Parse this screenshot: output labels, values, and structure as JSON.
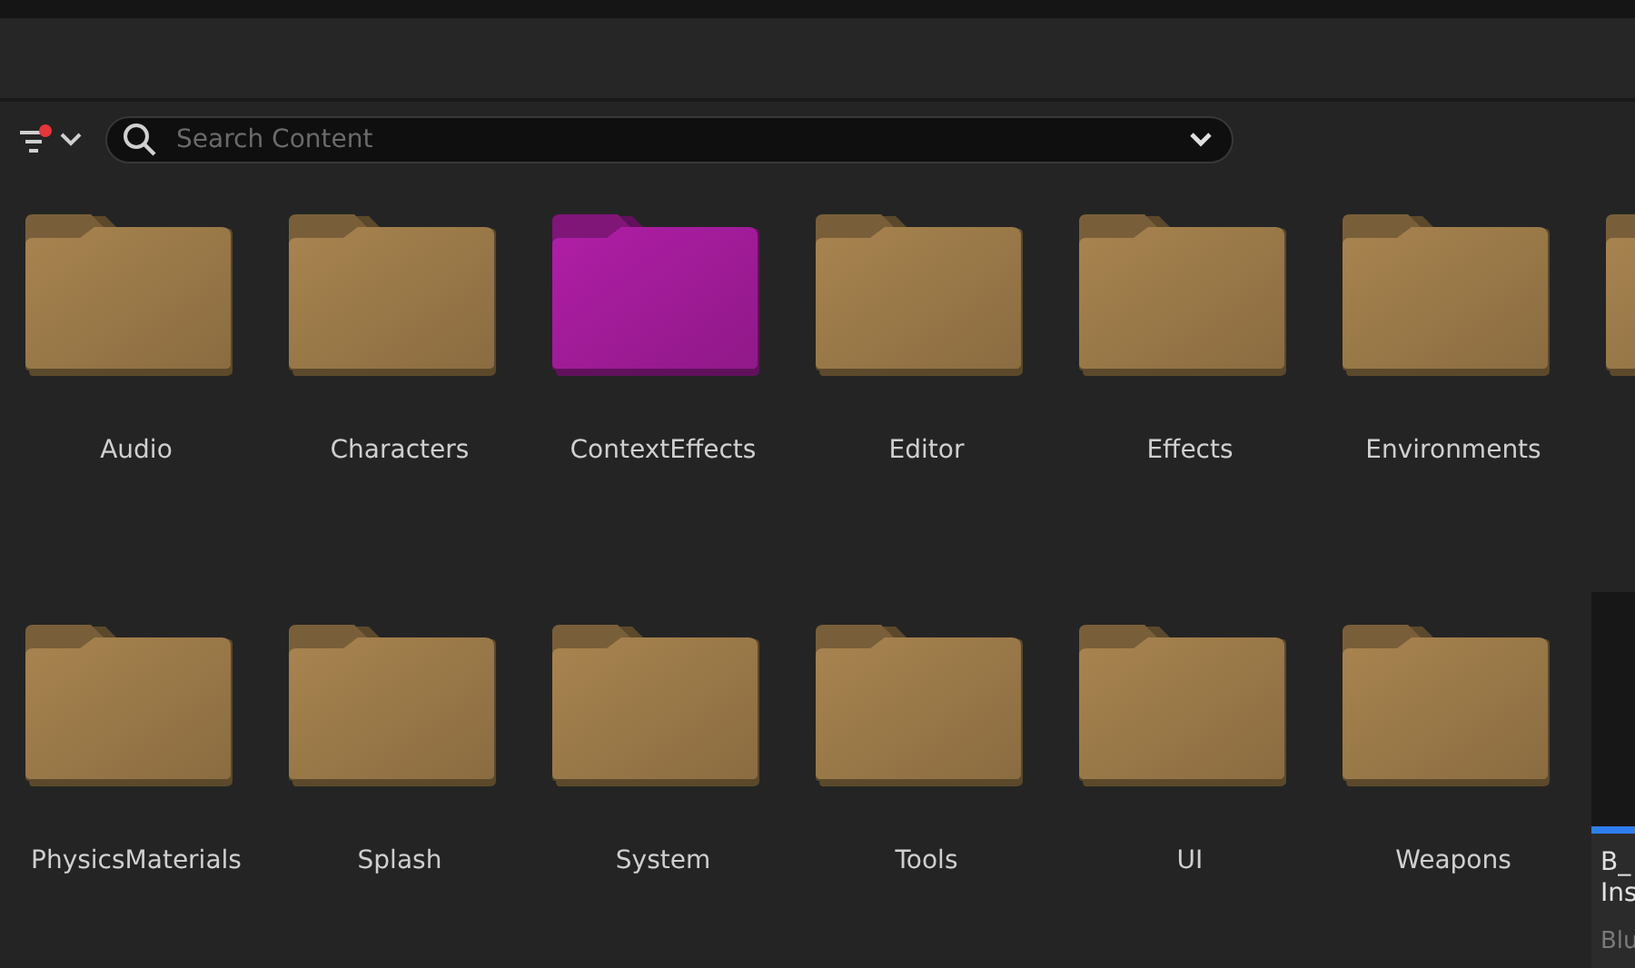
{
  "toolbar": {
    "filter_active": true,
    "search": {
      "placeholder": "Search Content"
    }
  },
  "items": [
    {
      "kind": "folder",
      "label": "Audio",
      "color": "#a8844f"
    },
    {
      "kind": "folder",
      "label": "Characters",
      "color": "#a8844f"
    },
    {
      "kind": "folder",
      "label": "ContextEffects",
      "color": "#b01ea6"
    },
    {
      "kind": "folder",
      "label": "Editor",
      "color": "#a8844f"
    },
    {
      "kind": "folder",
      "label": "Effects",
      "color": "#a8844f"
    },
    {
      "kind": "folder",
      "label": "Environments",
      "color": "#a8844f"
    },
    {
      "kind": "folder",
      "color": "#a8844f"
    },
    {
      "kind": "folder",
      "label": "PhysicsMaterials",
      "color": "#a8844f"
    },
    {
      "kind": "folder",
      "label": "Splash",
      "color": "#a8844f"
    },
    {
      "kind": "folder",
      "label": "System",
      "color": "#a8844f"
    },
    {
      "kind": "folder",
      "label": "Tools",
      "color": "#a8844f"
    },
    {
      "kind": "folder",
      "label": "UI",
      "color": "#a8844f"
    },
    {
      "kind": "folder",
      "label": "Weapons",
      "color": "#a8844f"
    },
    {
      "kind": "asset",
      "name_lines": [
        "B_",
        "Ins"
      ],
      "type": "Blu"
    }
  ]
}
